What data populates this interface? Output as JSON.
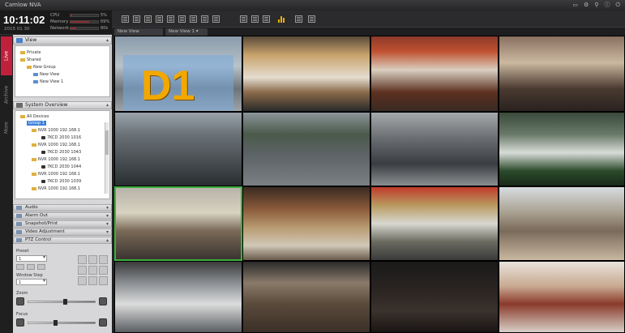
{
  "app": {
    "title": "Camlow NVA"
  },
  "window_controls": [
    "min-icon",
    "gear-icon",
    "pin-icon",
    "info-icon",
    "power-icon"
  ],
  "status": {
    "time": "10:11:02",
    "date": "2015 01 30",
    "meters": [
      {
        "label": "CPU",
        "value": "5%",
        "level": 0.05
      },
      {
        "label": "Memory",
        "value": "69%",
        "level": 0.69
      },
      {
        "label": "Network",
        "value": "80k",
        "level": 0.2
      }
    ]
  },
  "view_tabs": [
    {
      "label": "New View"
    },
    {
      "label": "New View 1 ▾"
    }
  ],
  "left_tabs": {
    "live": "Live",
    "archive": "Archive",
    "more": "More"
  },
  "view_panel": {
    "title": "View",
    "tree": [
      "Private",
      "Shared",
      "New Group",
      "New View",
      "New View 1"
    ]
  },
  "system_panel": {
    "title": "System Overview",
    "tree": [
      "All Devices",
      "Group 1",
      "NVR 1000 192.168.1",
      "7KCD 2030 1016",
      "NVR 1000 192.168.1",
      "7KCD 2030 1043",
      "NVR 1000 192.168.1",
      "7KCD 2030 1044",
      "NVR 1000 192.168.1",
      "7KCD 2030 1039",
      "NVR 1000 192.168.1"
    ]
  },
  "sections": [
    "Audio",
    "Alarm Out",
    "Snapshot/Print",
    "Video Adjustment",
    "PTZ Control"
  ],
  "ptz": {
    "preset_label": "Preset",
    "preset_value": "1",
    "window_step_label": "Window Step",
    "window_step_value": "1",
    "zoom_label": "Zoom",
    "zoom_level": 0.55,
    "focus_label": "Focus",
    "focus_level": 0.4
  },
  "overlay_label": "D1",
  "accent": "#c0203c",
  "active_border": "#3dae3d",
  "cameras": [
    "store-entrance",
    "deli-counter",
    "cashier-counter",
    "checkout-register",
    "parking-lot-1",
    "parking-lot-2",
    "parking-lot-3",
    "building-exterior",
    "jewelry-counter",
    "store-aisles",
    "convenience-store-checkout",
    "mall-atrium",
    "lobby-seating",
    "staircase",
    "dark-entrance",
    "hallway-lockers"
  ]
}
